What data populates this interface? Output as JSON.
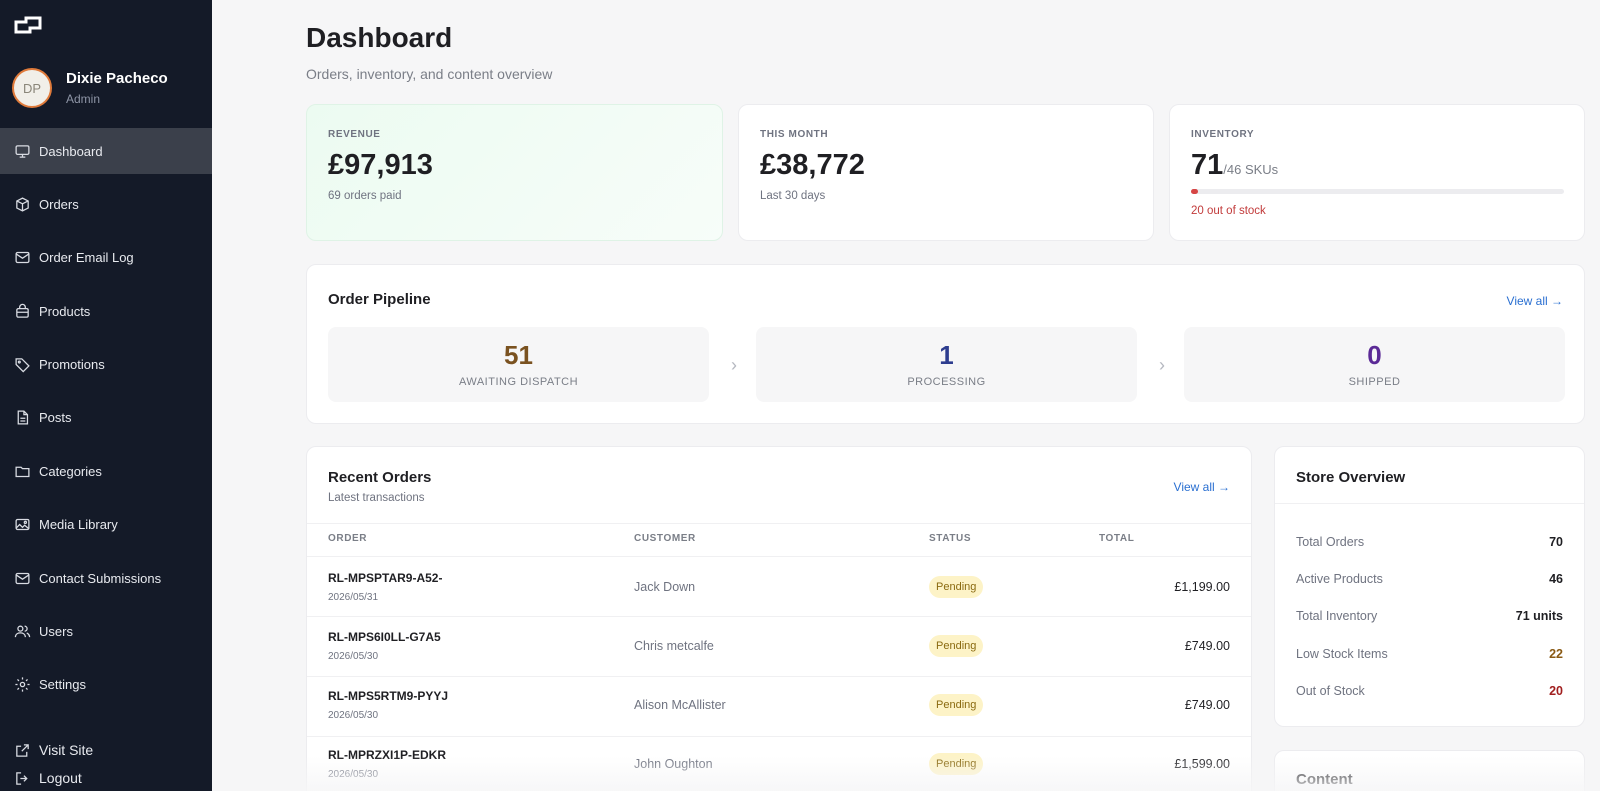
{
  "user": {
    "initials": "DP",
    "name": "Dixie Pacheco",
    "role": "Admin"
  },
  "nav": [
    {
      "label": "Dashboard",
      "icon": "monitor-icon",
      "active": true
    },
    {
      "label": "Orders",
      "icon": "box-icon"
    },
    {
      "label": "Order Email Log",
      "icon": "mail-icon"
    },
    {
      "label": "Products",
      "icon": "bag-icon"
    },
    {
      "label": "Promotions",
      "icon": "tag-icon"
    },
    {
      "label": "Posts",
      "icon": "document-icon"
    },
    {
      "label": "Categories",
      "icon": "folder-icon"
    },
    {
      "label": "Media Library",
      "icon": "image-icon"
    },
    {
      "label": "Contact Submissions",
      "icon": "mail-icon"
    },
    {
      "label": "Users",
      "icon": "users-icon"
    },
    {
      "label": "Settings",
      "icon": "gear-icon"
    }
  ],
  "nav_bottom": [
    {
      "label": "Visit Site",
      "icon": "external-link-icon"
    },
    {
      "label": "Logout",
      "icon": "logout-icon"
    }
  ],
  "page": {
    "title": "Dashboard",
    "subtitle": "Orders, inventory, and content overview"
  },
  "stats": {
    "revenue": {
      "label": "REVENUE",
      "value": "£97,913",
      "sub": "69 orders paid"
    },
    "month": {
      "label": "THIS MONTH",
      "value": "£38,772",
      "sub": "Last 30 days"
    },
    "inventory": {
      "label": "INVENTORY",
      "value": "71",
      "unit": "/46 SKUs",
      "sub": "20 out of stock",
      "fill_fraction": 0.02
    }
  },
  "pipeline": {
    "title": "Order Pipeline",
    "view_all": "View all →",
    "stages": [
      {
        "count": "51",
        "label": "AWAITING DISPATCH",
        "color": "#7a5220"
      },
      {
        "count": "1",
        "label": "PROCESSING",
        "color": "#2e3d8f"
      },
      {
        "count": "0",
        "label": "SHIPPED",
        "color": "#5b2a96"
      }
    ]
  },
  "recent_orders": {
    "title": "Recent Orders",
    "subtitle": "Latest transactions",
    "view_all": "View all →",
    "columns": [
      "ORDER",
      "CUSTOMER",
      "STATUS",
      "TOTAL"
    ],
    "rows": [
      {
        "id": "RL-MPSPTAR9-A52-",
        "date": "2026/05/31",
        "customer": "Jack Down",
        "status": "Pending",
        "total": "£1,199.00"
      },
      {
        "id": "RL-MPS6I0LL-G7A5",
        "date": "2026/05/30",
        "customer": "Chris metcalfe",
        "status": "Pending",
        "total": "£749.00"
      },
      {
        "id": "RL-MPS5RTM9-PYYJ",
        "date": "2026/05/30",
        "customer": "Alison McAllister",
        "status": "Pending",
        "total": "£749.00"
      },
      {
        "id": "RL-MPRZXI1P-EDKR",
        "date": "2026/05/30",
        "customer": "John Oughton",
        "status": "Pending",
        "total": "£1,599.00"
      }
    ]
  },
  "store_overview": {
    "title": "Store Overview",
    "rows": [
      {
        "label": "Total Orders",
        "value": "70"
      },
      {
        "label": "Active Products",
        "value": "46"
      },
      {
        "label": "Total Inventory",
        "value": "71 units"
      },
      {
        "label": "Low Stock Items",
        "value": "22"
      },
      {
        "label": "Out of Stock",
        "value": "20"
      }
    ]
  },
  "content_card": {
    "title": "Content"
  }
}
